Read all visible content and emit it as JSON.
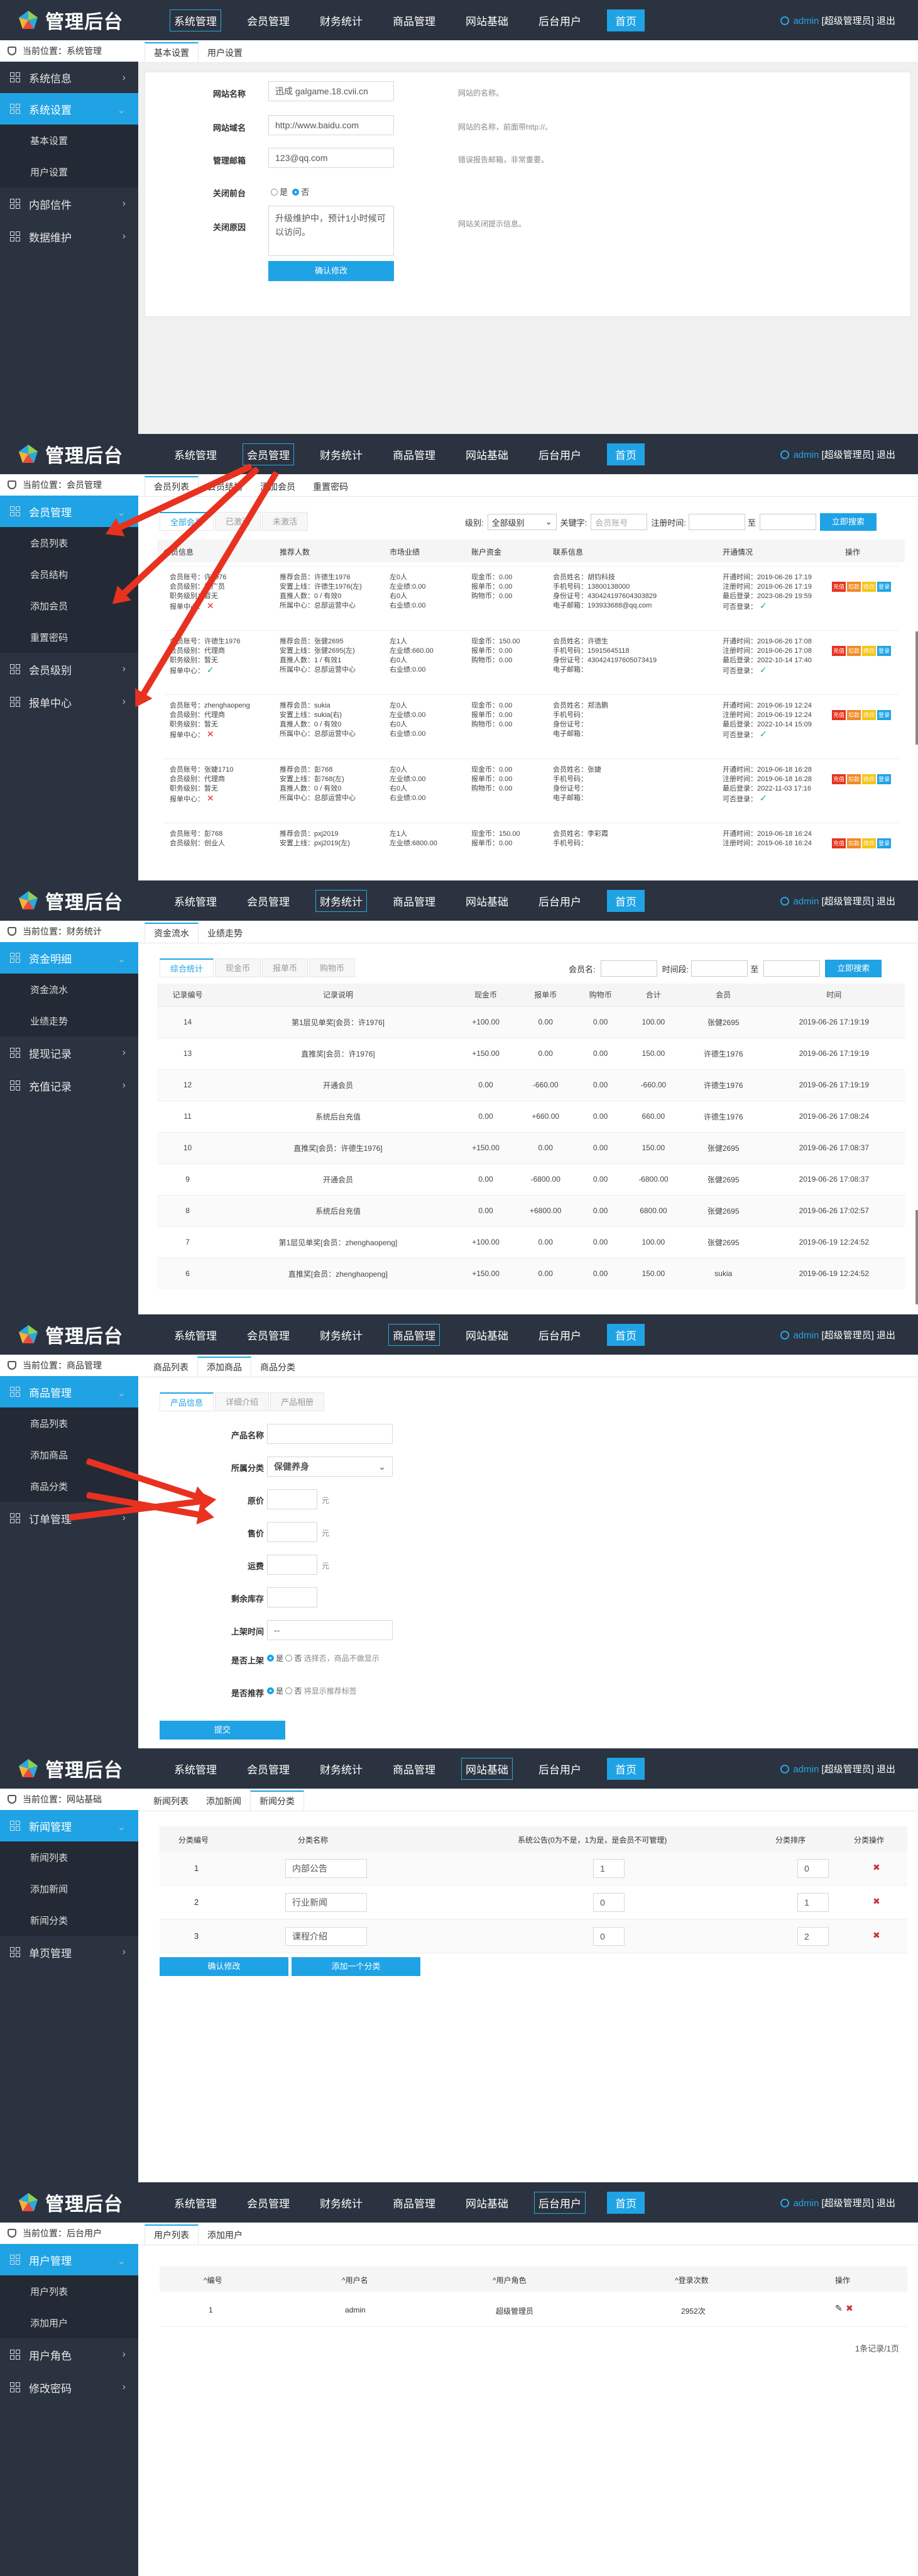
{
  "app": {
    "logo_text": "管理后台",
    "home": "首页",
    "nav": [
      "系统管理",
      "会员管理",
      "财务统计",
      "商品管理",
      "网站基础",
      "后台用户"
    ],
    "user_name": "admin",
    "user_role": "[超级管理员]",
    "logout": "退出"
  },
  "s1": {
    "crumb": "当前位置：系统管理",
    "side": [
      {
        "label": "系统信息"
      },
      {
        "label": "系统设置"
      }
    ],
    "subs": [
      "基本设置",
      "用户设置"
    ],
    "side_more": [
      {
        "label": "内部信件"
      },
      {
        "label": "数据维护"
      }
    ],
    "tabs": [
      "基本设置",
      "用户设置"
    ],
    "fields": [
      {
        "label": "网站名称",
        "value": "迅成 galgame.18.cvii.cn",
        "hint": "网站的名称。"
      },
      {
        "label": "网站域名",
        "value": "http://www.baidu.com",
        "hint": "网站的名称，前面带http://。"
      },
      {
        "label": "管理邮箱",
        "value": "123@qq.com",
        "hint": "错误报告邮箱，非常重要。"
      }
    ],
    "close_label": "关闭前台",
    "radio_yes": "是",
    "radio_no": "否",
    "reason_label": "关闭原因",
    "reason_value": "升级维护中，预计1小时候可以访问。",
    "reason_hint": "网站关闭提示信息。",
    "submit": "确认修改"
  },
  "s2": {
    "crumb": "当前位置：会员管理",
    "side_top": "会员管理",
    "subs": [
      "会员列表",
      "会员结构",
      "添加会员",
      "重置密码"
    ],
    "side_more": [
      {
        "label": "会员级别"
      },
      {
        "label": "报单中心"
      }
    ],
    "tabs": [
      "会员列表",
      "会员结构",
      "添加会员",
      "重置密码"
    ],
    "subtabs": [
      "全部会员",
      "已激活",
      "未激活"
    ],
    "filter": {
      "level_label": "级别:",
      "level_value": "全部级别",
      "kw_label": "关键字:",
      "kw_placeholder": "会员账号",
      "time_label": "注册时间:",
      "to": "至",
      "btn": "立即搜索"
    },
    "headers": [
      "会员信息",
      "推荐人数",
      "市场业绩",
      "账户资金",
      "联系信息",
      "开通情况",
      "操作"
    ],
    "ops": [
      "充值",
      "扣款",
      "修改",
      "登录"
    ],
    "members": [
      {
        "c1": [
          "会员账号：许1976",
          "会员级别：推广员",
          "职务级别：暂无",
          "报单中心："
        ],
        "c2": [
          "推荐会员：许德生1976",
          "安置上线：许德生1976(左)",
          "直推人数：0 / 有效0",
          "所属中心：总部运营中心"
        ],
        "c3": [
          "左业绩:0.00",
          "左业绩:0.00",
          "右业绩:0.00",
          "右业绩:0.00"
        ],
        "c3b": [
          "左0人",
          "左业绩:0.00",
          "右0人",
          "右业绩:0.00"
        ],
        "c4": [
          "现金币：0.00",
          "报单币：0.00",
          "购物币：0.00"
        ],
        "c5": [
          "会员姓名：胡钧科技",
          "手机号码：13800138000",
          "身份证号：430424197604303829",
          "电子邮箱：193933688@qq.com"
        ],
        "c6": [
          "开通时间：2019-06-26 17:19",
          "注册时间：2019-06-26 17:19",
          "最后登录：2023-08-29 19:59",
          "可否登录："
        ],
        "bc": "cross",
        "login_ok": true
      },
      {
        "c1": [
          "会员账号：许德生1976",
          "会员级别：代理商",
          "职务级别：暂无",
          "报单中心："
        ],
        "c2": [
          "推荐会员：张健2695",
          "安置上线：张健2695(左)",
          "直推人数：1 / 有效1",
          "所属中心：总部运营中心"
        ],
        "c3b": [
          "左1人",
          "左业绩:660.00",
          "右0人",
          "右业绩:0.00"
        ],
        "c4": [
          "现金币：150.00",
          "报单币：0.00",
          "购物币：0.00"
        ],
        "c5": [
          "会员姓名：许德生",
          "手机号码：15915645118",
          "身份证号：430424197605073419",
          "电子邮箱："
        ],
        "c6": [
          "开通时间：2019-06-26 17:08",
          "注册时间：2019-06-26 17:08",
          "最后登录：2022-10-14 17:40",
          "可否登录："
        ],
        "bc": "check",
        "login_ok": true
      },
      {
        "c1": [
          "会员账号：zhenghaopeng",
          "会员级别：代理商",
          "职务级别：暂无",
          "报单中心："
        ],
        "c2": [
          "推荐会员：sukia",
          "安置上线：sukia(右)",
          "直推人数：0 / 有效0",
          "所属中心：总部运营中心"
        ],
        "c3b": [
          "左0人",
          "左业绩:0.00",
          "右0人",
          "右业绩:0.00"
        ],
        "c4": [
          "现金币：0.00",
          "报单币：0.00",
          "购物币：0.00"
        ],
        "c5": [
          "会员姓名：郑浩鹏",
          "手机号码：",
          "身份证号：",
          "电子邮箱："
        ],
        "c6": [
          "开通时间：2019-06-19 12:24",
          "注册时间：2019-06-19 12:24",
          "最后登录：2022-10-14 15:09",
          "可否登录："
        ],
        "bc": "cross",
        "login_ok": true
      },
      {
        "c1": [
          "会员账号：张婕1710",
          "会员级别：代理商",
          "职务级别：暂无",
          "报单中心："
        ],
        "c2": [
          "推荐会员：彭768",
          "安置上线：彭768(左)",
          "直推人数：0 / 有效0",
          "所属中心：总部运营中心"
        ],
        "c3b": [
          "左0人",
          "左业绩:0.00",
          "右0人",
          "右业绩:0.00"
        ],
        "c4": [
          "现金币：0.00",
          "报单币：0.00",
          "购物币：0.00"
        ],
        "c5": [
          "会员姓名：张婕",
          "手机号码：",
          "身份证号：",
          "电子邮箱："
        ],
        "c6": [
          "开通时间：2019-06-18 16:28",
          "注册时间：2019-06-18 16:28",
          "最后登录：2022-11-03 17:16",
          "可否登录："
        ],
        "bc": "cross",
        "login_ok": true
      },
      {
        "c1": [
          "会员账号：彭768",
          "会员级别：创业人"
        ],
        "c2": [
          "推荐会员：pxj2019",
          "安置上线：pxj2019(左)"
        ],
        "c3b": [
          "左1人",
          "左业绩:6800.00"
        ],
        "c4": [
          "现金币：150.00",
          "报单币：0.00"
        ],
        "c5": [
          "会员姓名：李彩霞",
          "手机号码："
        ],
        "c6": [
          "开通时间：2019-06-18 16:24",
          "注册时间：2019-06-18 16:24"
        ],
        "bc": "",
        "login_ok": false
      }
    ]
  },
  "s3": {
    "crumb": "当前位置：财务统计",
    "side_top": "资金明细",
    "subs": [
      "资金流水",
      "业绩走势"
    ],
    "side_more": [
      {
        "label": "提现记录"
      },
      {
        "label": "充值记录"
      }
    ],
    "tabs": [
      "资金流水",
      "业绩走势"
    ],
    "subtabs": [
      "综合统计",
      "现金币",
      "报单币",
      "购物币"
    ],
    "filter": {
      "member_label": "会员名:",
      "time_label": "时间段:",
      "to": "至",
      "btn": "立即搜索"
    },
    "headers": [
      "记录编号",
      "记录说明",
      "现金币",
      "报单币",
      "购物币",
      "合计",
      "会员",
      "时间"
    ],
    "rows": [
      [
        "14",
        "第1层见单奖[会员：许1976]",
        "+100.00",
        "0.00",
        "0.00",
        "100.00",
        "张健2695",
        "2019-06-26 17:19:19"
      ],
      [
        "13",
        "直推奖[会员：许1976]",
        "+150.00",
        "0.00",
        "0.00",
        "150.00",
        "许德生1976",
        "2019-06-26 17:19:19"
      ],
      [
        "12",
        "开通会员",
        "0.00",
        "-660.00",
        "0.00",
        "-660.00",
        "许德生1976",
        "2019-06-26 17:19:19"
      ],
      [
        "11",
        "系统后台充值",
        "0.00",
        "+660.00",
        "0.00",
        "660.00",
        "许德生1976",
        "2019-06-26 17:08:24"
      ],
      [
        "10",
        "直推奖[会员：许德生1976]",
        "+150.00",
        "0.00",
        "0.00",
        "150.00",
        "张健2695",
        "2019-06-26 17:08:37"
      ],
      [
        "9",
        "开通会员",
        "0.00",
        "-6800.00",
        "0.00",
        "-6800.00",
        "张健2695",
        "2019-06-26 17:08:37"
      ],
      [
        "8",
        "系统后台充值",
        "0.00",
        "+6800.00",
        "0.00",
        "6800.00",
        "张健2695",
        "2019-06-26 17:02:57"
      ],
      [
        "7",
        "第1层见单奖[会员：zhenghaopeng]",
        "+100.00",
        "0.00",
        "0.00",
        "100.00",
        "张健2695",
        "2019-06-19 12:24:52"
      ],
      [
        "6",
        "直推奖[会员：zhenghaopeng]",
        "+150.00",
        "0.00",
        "0.00",
        "150.00",
        "sukia",
        "2019-06-19 12:24:52"
      ]
    ]
  },
  "s4": {
    "crumb": "当前位置：商品管理",
    "side_top": "商品管理",
    "subs": [
      "商品列表",
      "添加商品",
      "商品分类"
    ],
    "side_more": [
      {
        "label": "订单管理"
      }
    ],
    "tabs": [
      "商品列表",
      "添加商品",
      "商品分类"
    ],
    "subtabs": [
      "产品信息",
      "详细介绍",
      "产品相册"
    ],
    "fields": [
      {
        "label": "产品名称",
        "value": ""
      },
      {
        "label": "所属分类",
        "value": "保健养身"
      },
      {
        "label": "原价",
        "value": "",
        "unit": "元"
      },
      {
        "label": "售价",
        "value": "",
        "unit": "元"
      },
      {
        "label": "运费",
        "value": "",
        "unit": "元"
      },
      {
        "label": "剩余库存",
        "value": ""
      },
      {
        "label": "上架时间",
        "value": "--"
      }
    ],
    "onsale": {
      "label": "是否上架",
      "yes": "是",
      "no": "否",
      "hint": "选择否，商品不做显示"
    },
    "recommend": {
      "label": "是否推荐",
      "yes": "是",
      "no": "否",
      "hint": "将显示推荐标签"
    },
    "submit": "提交"
  },
  "s5": {
    "crumb": "当前位置：网站基础",
    "side_top": "新闻管理",
    "subs": [
      "新闻列表",
      "添加新闻",
      "新闻分类"
    ],
    "side_more": [
      {
        "label": "单页管理"
      }
    ],
    "tabs": [
      "新闻列表",
      "添加新闻",
      "新闻分类"
    ],
    "headers": [
      "分类编号",
      "分类名称",
      "系统公告(0为不是，1为是，是会员不可管理)",
      "分类排序",
      "分类操作"
    ],
    "rows": [
      {
        "id": "1",
        "name": "内部公告",
        "sys": "1",
        "sort": "0"
      },
      {
        "id": "2",
        "name": "行业新闻",
        "sys": "0",
        "sort": "1"
      },
      {
        "id": "3",
        "name": "课程介绍",
        "sys": "0",
        "sort": "2"
      }
    ],
    "btn_save": "确认修改",
    "btn_add": "添加一个分类"
  },
  "s6": {
    "crumb": "当前位置：后台用户",
    "side_top": "用户管理",
    "subs": [
      "用户列表",
      "添加用户"
    ],
    "side_more": [
      {
        "label": "用户角色"
      },
      {
        "label": "修改密码"
      }
    ],
    "tabs": [
      "用户列表",
      "添加用户"
    ],
    "headers": [
      "编号",
      "用户名",
      "用户角色",
      "登录次数",
      "操作"
    ],
    "rows": [
      {
        "id": "1",
        "name": "admin",
        "role": "超级管理员",
        "logins": "2952次"
      }
    ],
    "footer": "1条记录/1页"
  }
}
